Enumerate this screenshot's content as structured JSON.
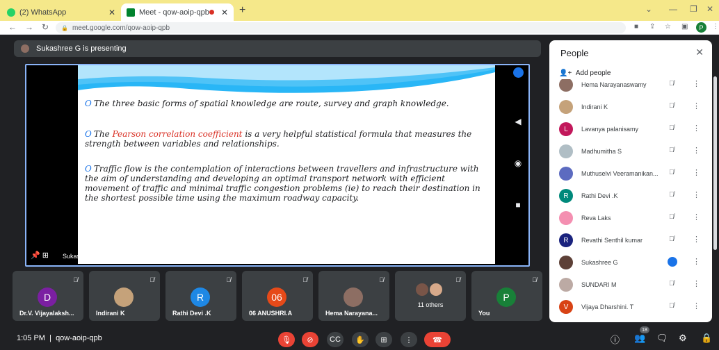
{
  "browser": {
    "tabs": [
      {
        "title": "(2) WhatsApp",
        "favicon_color": "#25d366"
      },
      {
        "title": "Meet - qow-aoip-qpb",
        "favicon_color": "#00832d"
      }
    ],
    "url": "meet.google.com/qow-aoip-qpb",
    "profile_initial": "P"
  },
  "meeting": {
    "presenter_banner": "Sukashree G is presenting",
    "presenter_tag": "Sukashree G",
    "time": "1:05 PM",
    "code": "qow-aoip-qpb",
    "participant_count": "18"
  },
  "slide": {
    "bullet_marker": "O",
    "b1": "The three basic forms of spatial knowledge are route, survey and graph knowledge.",
    "b2_pre": "The ",
    "b2_highlight": "Pearson correlation coefficient",
    "b2_post": " is a very helpful statistical formula that measures the strength between variables and relationships.",
    "b3": "Traffic flow is the contemplation of interactions between travellers and infrastructure with the aim of understanding and developing an optimal transport network with efficient movement of traffic and minimal traffic congestion problems (ie) to reach their destination in the shortest possible time using the maximum roadway capacity."
  },
  "tiles": [
    {
      "name": "Dr.V. Vijayalaksh...",
      "initial": "D",
      "color": "#7b1fa2"
    },
    {
      "name": "Indirani K",
      "initial": "",
      "color": "#c5a27a"
    },
    {
      "name": "Rathi Devi .K",
      "initial": "R",
      "color": "#1e88e5"
    },
    {
      "name": "06 ANUSHRI.A",
      "initial": "06",
      "color": "#e64a19"
    },
    {
      "name": "Hema Narayana...",
      "initial": "",
      "color": "#8d6e63"
    },
    {
      "name": "11 others",
      "initial": "",
      "color": "#795548"
    },
    {
      "name": "You",
      "initial": "P",
      "color": "#188038"
    }
  ],
  "people": {
    "title": "People",
    "add_label": "Add people",
    "list": [
      {
        "name": "Hema Narayanaswamy",
        "initial": "",
        "color": "#8d6e63"
      },
      {
        "name": "Indirani K",
        "initial": "",
        "color": "#c5a27a"
      },
      {
        "name": "Lavanya palanisamy",
        "initial": "L",
        "color": "#c2185b"
      },
      {
        "name": "Madhumitha S",
        "initial": "",
        "color": "#b0bec5"
      },
      {
        "name": "Muthuselvi Veeramanikan...",
        "initial": "",
        "color": "#5c6bc0"
      },
      {
        "name": "Rathi Devi .K",
        "initial": "R",
        "color": "#00897b"
      },
      {
        "name": "Reva Laks",
        "initial": "",
        "color": "#f48fb1"
      },
      {
        "name": "Revathi Senthil kumar",
        "initial": "R",
        "color": "#1a237e"
      },
      {
        "name": "Sukashree G",
        "initial": "",
        "color": "#5d4037"
      },
      {
        "name": "SUNDARI M",
        "initial": "",
        "color": "#bcaaa4"
      },
      {
        "name": "Vijaya Dharshini. T",
        "initial": "V",
        "color": "#d84315"
      }
    ]
  }
}
